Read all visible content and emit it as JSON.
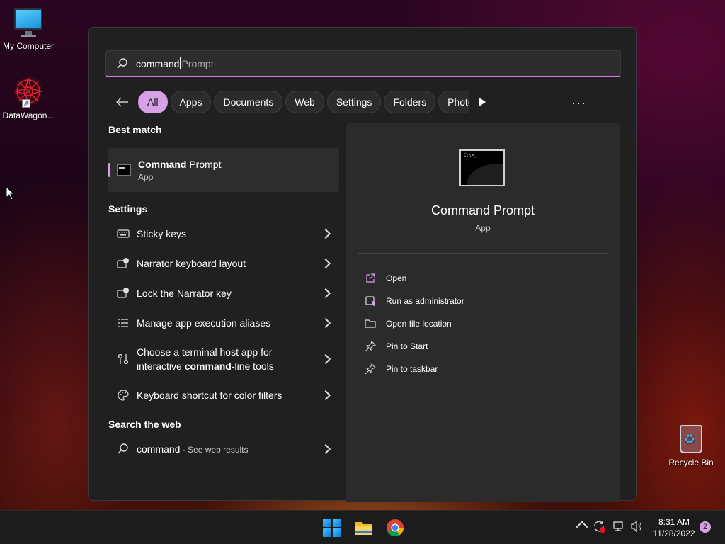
{
  "desktop": {
    "icons": [
      {
        "label": "My Computer"
      },
      {
        "label": "DataWagon..."
      },
      {
        "label": "Recycle Bin"
      }
    ]
  },
  "search": {
    "typed": "command",
    "suggestion": " Prompt"
  },
  "filters": {
    "items": [
      {
        "label": "All",
        "active": true
      },
      {
        "label": "Apps"
      },
      {
        "label": "Documents"
      },
      {
        "label": "Web"
      },
      {
        "label": "Settings"
      },
      {
        "label": "Folders"
      },
      {
        "label": "Photos"
      }
    ],
    "more_label": "···"
  },
  "best_match": {
    "heading": "Best match",
    "title_bold": "Command",
    "title_rest": " Prompt",
    "subtitle": "App"
  },
  "settings": {
    "heading": "Settings",
    "items": [
      {
        "label": "Sticky keys",
        "icon": "keyboard-icon"
      },
      {
        "label": "Narrator keyboard layout",
        "icon": "narrator-icon"
      },
      {
        "label": "Lock the Narrator key",
        "icon": "narrator-lock-icon"
      },
      {
        "label": "Manage app execution aliases",
        "icon": "list-icon"
      },
      {
        "label_line1": "Choose a terminal host app for",
        "label_pre": "interactive ",
        "label_bold": "command",
        "label_post": "-line tools",
        "icon": "terminal-settings-icon"
      },
      {
        "label": "Keyboard shortcut for color filters",
        "icon": "palette-icon"
      }
    ]
  },
  "web": {
    "heading": "Search the web",
    "query": "command",
    "suffix": " - See web results"
  },
  "preview": {
    "title": "Command Prompt",
    "subtitle": "App",
    "icon_text": "C:\\>_",
    "actions": [
      {
        "label": "Open",
        "icon": "open-external-icon"
      },
      {
        "label": "Run as administrator",
        "icon": "shield-icon"
      },
      {
        "label": "Open file location",
        "icon": "folder-icon"
      },
      {
        "label": "Pin to Start",
        "icon": "pin-icon"
      },
      {
        "label": "Pin to taskbar",
        "icon": "pin-icon"
      }
    ]
  },
  "taskbar": {
    "time": "8:31 AM",
    "date": "11/28/2022",
    "notification_count": "2"
  },
  "colors": {
    "accent": "#d8a0e6",
    "panel": "#202020",
    "taskbar": "#1c1c1c"
  }
}
